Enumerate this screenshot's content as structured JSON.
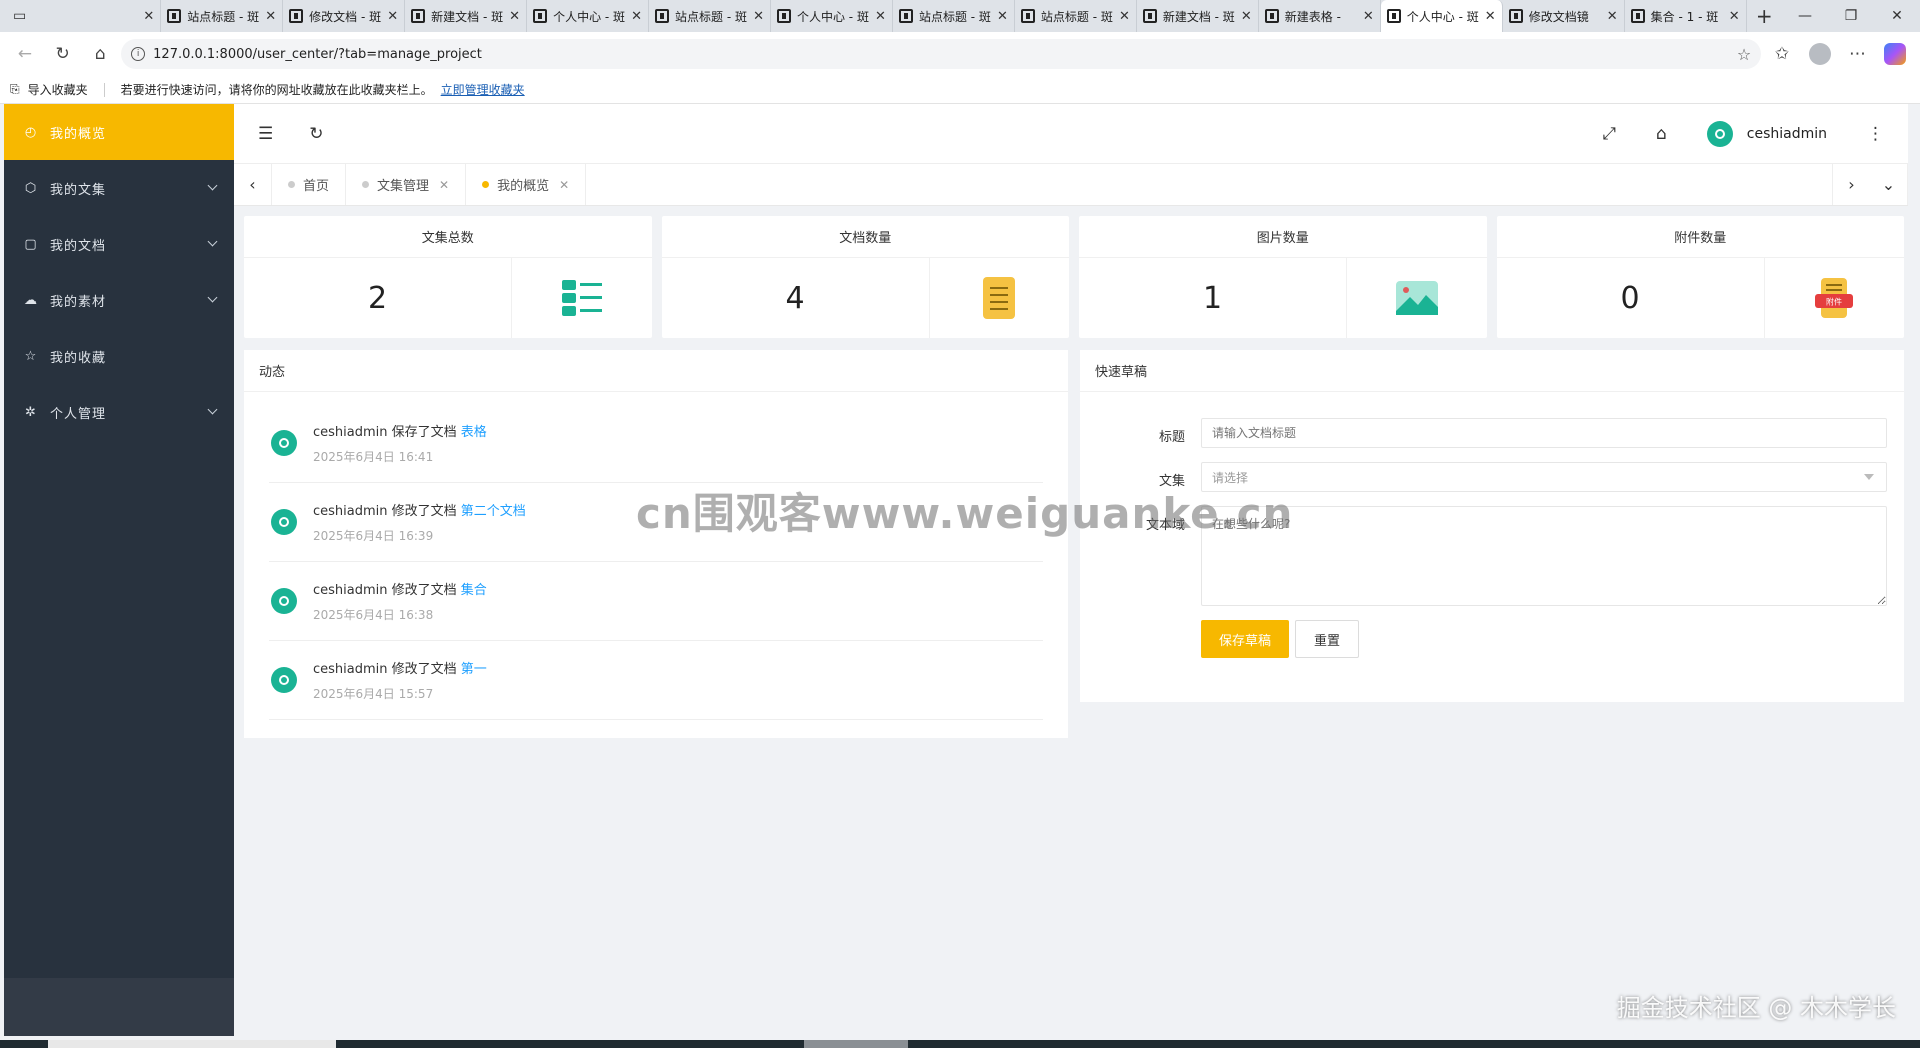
{
  "browser": {
    "tabs": [
      {
        "title": "",
        "active": false
      },
      {
        "title": "站点标题 - 斑",
        "active": false
      },
      {
        "title": "修改文档 - 斑",
        "active": false
      },
      {
        "title": "新建文档 - 斑",
        "active": false
      },
      {
        "title": "个人中心 - 斑",
        "active": false
      },
      {
        "title": "站点标题 - 斑",
        "active": false
      },
      {
        "title": "个人中心 - 斑",
        "active": false
      },
      {
        "title": "站点标题 - 斑",
        "active": false
      },
      {
        "title": "站点标题 - 斑",
        "active": false
      },
      {
        "title": "新建文档 - 斑",
        "active": false
      },
      {
        "title": "新建表格 -",
        "active": false
      },
      {
        "title": "个人中心 - 斑",
        "active": true
      },
      {
        "title": "修改文档镜",
        "active": false
      },
      {
        "title": "集合 - 1 - 斑",
        "active": false
      }
    ],
    "url": "127.0.0.1:8000/user_center/?tab=manage_project",
    "favbar": {
      "import_label": "导入收藏夹",
      "hint": "若要进行快速访问，请将你的网址收藏放在此收藏夹栏上。",
      "manage_link": "立即管理收藏夹"
    }
  },
  "sidebar": {
    "items": [
      {
        "label": "我的概览",
        "icon": "dashboard-icon",
        "glyph": "◴",
        "active": true,
        "has_children": false
      },
      {
        "label": "我的文集",
        "icon": "cube-icon",
        "glyph": "⬡",
        "active": false,
        "has_children": true
      },
      {
        "label": "我的文档",
        "icon": "note-icon",
        "glyph": "▢",
        "active": false,
        "has_children": true
      },
      {
        "label": "我的素材",
        "icon": "cloud-upload-icon",
        "glyph": "☁",
        "active": false,
        "has_children": true
      },
      {
        "label": "我的收藏",
        "icon": "star-icon",
        "glyph": "☆",
        "active": false,
        "has_children": false
      },
      {
        "label": "个人管理",
        "icon": "gear-icon",
        "glyph": "✲",
        "active": false,
        "has_children": true
      }
    ]
  },
  "header": {
    "username": "ceshiadmin"
  },
  "page_tabs": [
    {
      "label": "首页",
      "active": false,
      "closable": false
    },
    {
      "label": "文集管理",
      "active": false,
      "closable": true
    },
    {
      "label": "我的概览",
      "active": true,
      "closable": true
    }
  ],
  "stats": [
    {
      "title": "文集总数",
      "value": "2",
      "icon": "list-icon"
    },
    {
      "title": "文档数量",
      "value": "4",
      "icon": "document-icon"
    },
    {
      "title": "图片数量",
      "value": "1",
      "icon": "image-icon"
    },
    {
      "title": "附件数量",
      "value": "0",
      "icon": "attachment-icon",
      "badge": "附件"
    }
  ],
  "activity": {
    "title": "动态",
    "items": [
      {
        "text": "ceshiadmin 保存了文档",
        "doc": "表格",
        "time": "2025年6月4日 16:41"
      },
      {
        "text": "ceshiadmin 修改了文档",
        "doc": "第二个文档",
        "time": "2025年6月4日 16:39"
      },
      {
        "text": "ceshiadmin 修改了文档",
        "doc": "集合",
        "time": "2025年6月4日 16:38"
      },
      {
        "text": "ceshiadmin 修改了文档",
        "doc": "第一",
        "time": "2025年6月4日 15:57"
      }
    ]
  },
  "draft": {
    "title": "快速草稿",
    "title_label": "标题",
    "title_placeholder": "请输入文档标题",
    "collection_label": "文集",
    "collection_placeholder": "请选择",
    "textarea_label": "文本域",
    "textarea_placeholder": "在想些什么呢?",
    "save_label": "保存草稿",
    "reset_label": "重置"
  },
  "watermarks": {
    "center": "cn围观客www.weiguanke.cn",
    "corner": "掘金技术社区 @ 木木学长"
  },
  "colors": {
    "accent": "#f7b800",
    "sidebar": "#28323e",
    "link": "#1e9fff",
    "avatar": "#1ab394"
  }
}
